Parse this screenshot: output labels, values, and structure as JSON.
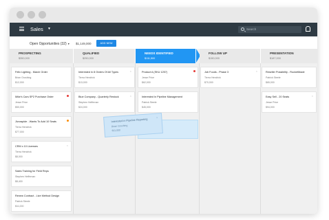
{
  "app": {
    "title": "Sales"
  },
  "search": {
    "placeholder": "Search"
  },
  "toolbar": {
    "opportunities_label": "Open Opportunities (32)",
    "total": "$1,149,000",
    "add_label": "ADD NEW"
  },
  "stages": [
    {
      "name": "PROSPECTING",
      "amount": "$350,000"
    },
    {
      "name": "QUALIFIED",
      "amount": "$250,000"
    },
    {
      "name": "NEEDS IDENTIFIED",
      "amount": "$111,500"
    },
    {
      "name": "FOLLOW UP",
      "amount": "$150,000"
    },
    {
      "name": "PRESENTATION",
      "amount": "$187,000"
    }
  ],
  "cards": {
    "prospecting": [
      {
        "title": "Felix Lighting - March Order",
        "contact": "Brian Grushing",
        "value": "$12,000"
      },
      {
        "title": "Mike's Cars SP2 Purchase Order",
        "contact": "Jesse Price",
        "value": "$50,000"
      },
      {
        "title": "Jivorapide - Wants To Add 10 Seats",
        "contact": "Tierra Hendrick",
        "value": "$77,000"
      },
      {
        "title": "CRM x 10 Licenses",
        "contact": "Tierra Hendrick",
        "value": "$8,000"
      },
      {
        "title": "Sales Training for Field Reps",
        "contact": "Stephen Heffernan",
        "value": "$8,400"
      },
      {
        "title": "Renew Contract - Live Method Design",
        "contact": "Patrick Steele",
        "value": "$11,000"
      }
    ],
    "qualified": [
      {
        "title": "Interested in 8 Orders Of All Types",
        "contact": "Tierra Hendrick",
        "value": "$13,000"
      },
      {
        "title": "Blue Company - Quarterly Restock",
        "contact": "Stephen Heffernan",
        "value": "$24,000"
      }
    ],
    "needs": [
      {
        "title": "Product A (SKU 1257)",
        "contact": "Jesse Price",
        "value": "$62,000"
      },
      {
        "title": "Interested In Pipeline Management",
        "contact": "Patrick Steele",
        "value": "$45,000"
      }
    ],
    "followup": [
      {
        "title": "Job Foods - Phase 3",
        "contact": "Tierra Hendrick",
        "value": "$70,000"
      }
    ],
    "presentation": [
      {
        "title": "Reseller Possibility - RocketMade",
        "contact": "Patrick Steele",
        "value": "$65,000"
      },
      {
        "title": "Easy Sell - 20 Seats",
        "contact": "Jesse Price",
        "value": "$94,000"
      }
    ],
    "dragging": {
      "title": "Interested in Pipeline Reporting",
      "contact": "Brian Grushing",
      "value": "$11,000"
    }
  },
  "colors": {
    "accent": "#2196f3",
    "flag_red": "#e53935",
    "flag_orange": "#fb8c00"
  }
}
